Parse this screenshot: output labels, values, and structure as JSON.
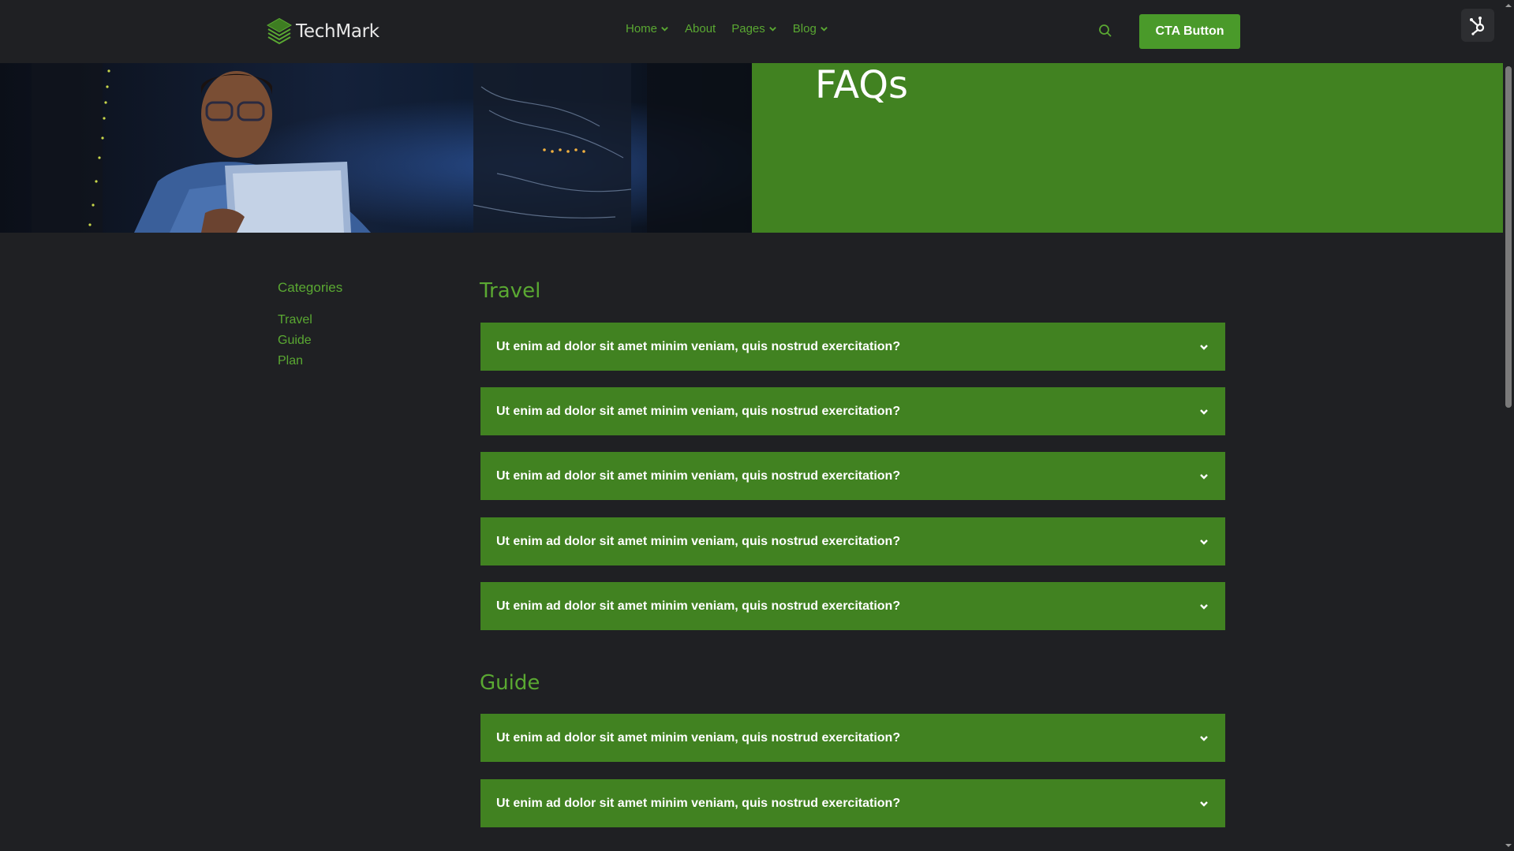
{
  "brand": {
    "name": "TechMark"
  },
  "nav": {
    "items": [
      {
        "label": "Home",
        "dropdown": true
      },
      {
        "label": "About",
        "dropdown": false
      },
      {
        "label": "Pages",
        "dropdown": true
      },
      {
        "label": "Blog",
        "dropdown": true
      }
    ],
    "cta_label": "CTA Button"
  },
  "hero": {
    "title": "FAQs"
  },
  "sidebar": {
    "title": "Categories",
    "links": [
      "Travel",
      "Guide",
      "Plan"
    ]
  },
  "sections": [
    {
      "title": "Travel",
      "questions": [
        "Ut enim ad dolor sit amet minim veniam, quis nostrud exercitation?",
        "Ut enim ad dolor sit amet minim veniam, quis nostrud exercitation?",
        "Ut enim ad dolor sit amet minim veniam, quis nostrud exercitation?",
        "Ut enim ad dolor sit amet minim veniam, quis nostrud exercitation?",
        "Ut enim ad dolor sit amet minim veniam, quis nostrud exercitation?"
      ]
    },
    {
      "title": "Guide",
      "questions": [
        "Ut enim ad dolor sit amet minim veniam, quis nostrud exercitation?",
        "Ut enim ad dolor sit amet minim veniam, quis nostrud exercitation?"
      ]
    }
  ],
  "icons": {
    "logo": "layered-diamond-logo-icon",
    "search": "search-icon",
    "dropdown": "chevron-down-icon",
    "hubspot": "hubspot-sprocket-icon"
  },
  "colors": {
    "background": "#1f2023",
    "accent": "#418221",
    "accent_text": "#5aa832",
    "button": "#4a9a2a"
  }
}
